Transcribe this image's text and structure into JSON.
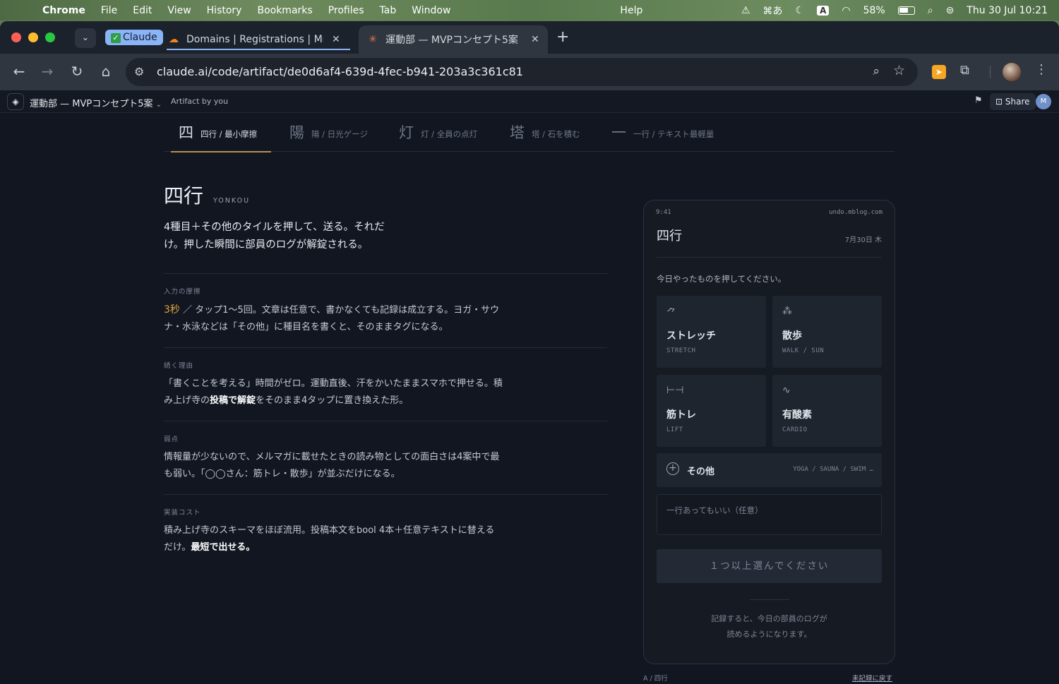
{
  "menubar": {
    "app": "Chrome",
    "items": [
      "File",
      "Edit",
      "View",
      "History",
      "Bookmarks",
      "Profiles",
      "Tab",
      "Window",
      "Help"
    ],
    "input_kana": "⌘あ",
    "input_a": "A",
    "battery": "58%",
    "clock": "Thu 30 Jul  10:21"
  },
  "browser": {
    "tab_group_label": "Claude",
    "tabs": [
      {
        "title": "Domains | Registrations | Mnb",
        "favicon": "cloud-icon"
      },
      {
        "title": "運動部 — MVPコンセプト5案",
        "favicon": "claude-spark-icon"
      }
    ],
    "url": "claude.ai/code/artifact/de0d6af4-639d-4fec-b941-203a3c361c81"
  },
  "artifact_bar": {
    "title": "運動部 — MVPコンセプト5案",
    "by": "Artifact by you",
    "share": "Share",
    "avatar": "M"
  },
  "concept_tabs": [
    {
      "kanji": "四",
      "label": "四行 / 最小摩擦"
    },
    {
      "kanji": "陽",
      "label": "陽 / 日光ゲージ"
    },
    {
      "kanji": "灯",
      "label": "灯 / 全員の点灯"
    },
    {
      "kanji": "塔",
      "label": "塔 / 石を積む"
    },
    {
      "kanji": "一",
      "label": "一行 / テキスト最軽量"
    }
  ],
  "detail": {
    "title": "四行",
    "romaji": "YONKOU",
    "lead": "4種目＋その他のタイルを押して、送る。それだけ。押した瞬間に部員のログが解錠される。",
    "sections": [
      {
        "caption": "入力の摩擦",
        "accent": "3秒",
        "text": " ／ タップ1〜5回。文章は任意で、書かなくても記録は成立する。ヨガ・サウナ・水泳などは「その他」に種目名を書くと、そのままタグになる。"
      },
      {
        "caption": "続く理由",
        "pre": "「書くことを考える」時間がゼロ。運動直後、汗をかいたままスマホで押せる。積み上げ寺の",
        "bold": "投稿で解錠",
        "post": "をそのまま4タップに置き換えた形。"
      },
      {
        "caption": "弱点",
        "text": "情報量が少ないので、メルマガに載せたときの読み物としての面白さは4案中で最も弱い。「◯◯さん：筋トレ・散歩」が並ぶだけになる。"
      },
      {
        "caption": "実装コスト",
        "pre": "積み上げ寺のスキーマをほぼ流用。投稿本文をbool 4本＋任意テキストに替えるだけ。",
        "bold": "最短で出せる。"
      }
    ]
  },
  "phone": {
    "time": "9:41",
    "domain": "undo.mblog.com",
    "title": "四行",
    "date": "7月30日 木",
    "prompt": "今日やったものを押してください。",
    "tiles": [
      {
        "icon": "stretch-icon",
        "glyph": "⺈",
        "name": "ストレッチ",
        "en": "STRETCH"
      },
      {
        "icon": "walk-sun-icon",
        "glyph": "⁂",
        "name": "散歩",
        "en": "WALK / SUN"
      },
      {
        "icon": "dumbbell-icon",
        "glyph": "⊢⊣",
        "name": "筋トレ",
        "en": "LIFT"
      },
      {
        "icon": "pulse-icon",
        "glyph": "∿",
        "name": "有酸素",
        "en": "CARDIO"
      }
    ],
    "other": {
      "name": "その他",
      "en": "YOGA / SAUNA / SWIM …"
    },
    "note_placeholder": "一行あってもいい（任意）",
    "submit": "１つ以上選んでください",
    "footer_1": "記録すると、今日の部員のログが",
    "footer_2": "読めるようになります。"
  },
  "footer": {
    "crumb": "A  /  四行",
    "back": "未記録に戻す"
  }
}
